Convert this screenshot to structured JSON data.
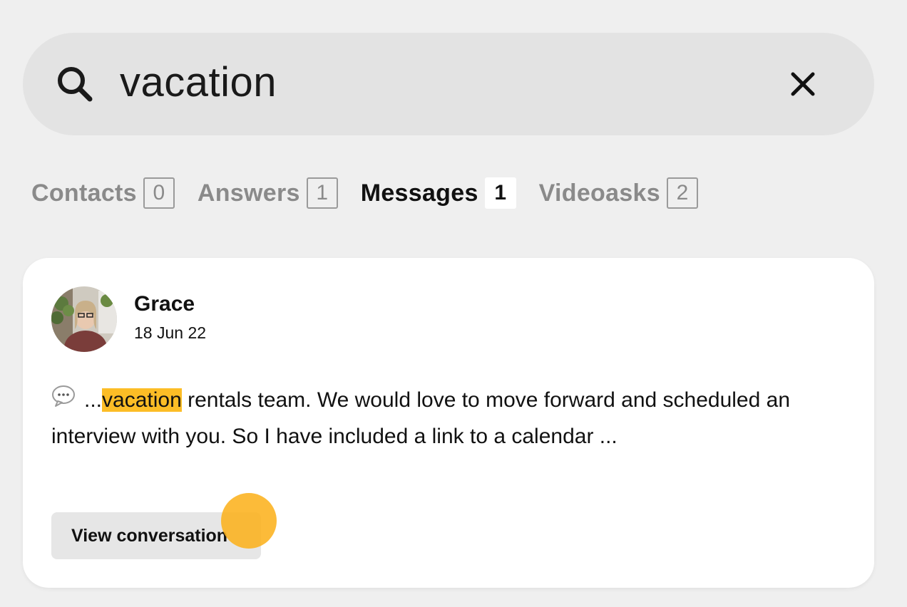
{
  "search": {
    "query": "vacation",
    "search_icon": "search-icon",
    "clear_icon": "close-icon"
  },
  "tabs": [
    {
      "label": "Contacts",
      "count": "0",
      "active": false
    },
    {
      "label": "Answers",
      "count": "1",
      "active": false
    },
    {
      "label": "Messages",
      "count": "1",
      "active": true
    },
    {
      "label": "Videoasks",
      "count": "2",
      "active": false
    }
  ],
  "result": {
    "author": "Grace",
    "date": "18 Jun 22",
    "message_icon": "speech-bubble-icon",
    "snippet_prefix": "...",
    "snippet_match": "vacation",
    "snippet_rest": " rentals team. We would love to move forward and scheduled an interview with you. So I have included a link to a calendar ...",
    "view_button": "View conversation"
  },
  "colors": {
    "highlight": "#fcbd26",
    "cursor": "#fcb21e",
    "background": "#efefef",
    "card": "#ffffff",
    "search_bar": "#e3e3e3"
  }
}
